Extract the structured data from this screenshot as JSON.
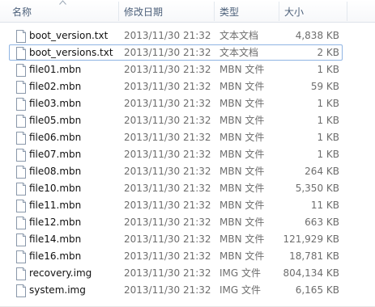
{
  "columns": {
    "name": "名称",
    "date": "修改日期",
    "type": "类型",
    "size": "大小"
  },
  "sort": {
    "column": "name",
    "direction": "ascending"
  },
  "focused_row": 1,
  "files": [
    {
      "name": "boot_version.txt",
      "date": "2013/11/30 21:32",
      "type": "文本文档",
      "size": "4,838 KB"
    },
    {
      "name": "boot_versions.txt",
      "date": "2013/11/30 21:32",
      "type": "文本文档",
      "size": "2 KB"
    },
    {
      "name": "file01.mbn",
      "date": "2013/11/30 21:32",
      "type": "MBN 文件",
      "size": "1 KB"
    },
    {
      "name": "file02.mbn",
      "date": "2013/11/30 21:32",
      "type": "MBN 文件",
      "size": "59 KB"
    },
    {
      "name": "file03.mbn",
      "date": "2013/11/30 21:32",
      "type": "MBN 文件",
      "size": "1 KB"
    },
    {
      "name": "file05.mbn",
      "date": "2013/11/30 21:32",
      "type": "MBN 文件",
      "size": "1 KB"
    },
    {
      "name": "file06.mbn",
      "date": "2013/11/30 21:32",
      "type": "MBN 文件",
      "size": "1 KB"
    },
    {
      "name": "file07.mbn",
      "date": "2013/11/30 21:32",
      "type": "MBN 文件",
      "size": "1 KB"
    },
    {
      "name": "file08.mbn",
      "date": "2013/11/30 21:32",
      "type": "MBN 文件",
      "size": "264 KB"
    },
    {
      "name": "file10.mbn",
      "date": "2013/11/30 21:32",
      "type": "MBN 文件",
      "size": "5,350 KB"
    },
    {
      "name": "file11.mbn",
      "date": "2013/11/30 21:32",
      "type": "MBN 文件",
      "size": "11 KB"
    },
    {
      "name": "file12.mbn",
      "date": "2013/11/30 21:32",
      "type": "MBN 文件",
      "size": "663 KB"
    },
    {
      "name": "file14.mbn",
      "date": "2013/11/30 21:32",
      "type": "MBN 文件",
      "size": "121,929 KB"
    },
    {
      "name": "file16.mbn",
      "date": "2013/11/30 21:32",
      "type": "MBN 文件",
      "size": "18,781 KB"
    },
    {
      "name": "recovery.img",
      "date": "2013/11/30 21:32",
      "type": "IMG 文件",
      "size": "804,134 KB"
    },
    {
      "name": "system.img",
      "date": "2013/11/30 21:32",
      "type": "IMG 文件",
      "size": "6,165 KB"
    }
  ],
  "icons": {
    "file": "file-icon",
    "sort": "sort-up-icon"
  },
  "colors": {
    "header_text": "#4c607a",
    "meta_text": "#6d6d6d",
    "focus_border": "#8fb4e3",
    "icon_border": "#8a98aa"
  }
}
